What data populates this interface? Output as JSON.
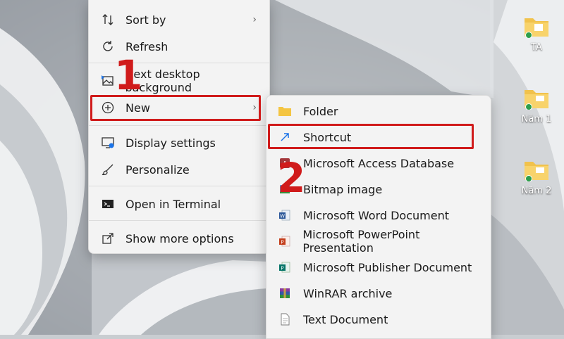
{
  "main_menu": {
    "items": [
      {
        "label": "Sort by",
        "icon": "sort-icon"
      },
      {
        "label": "Refresh",
        "icon": "refresh-icon"
      },
      {
        "label": "Next desktop background",
        "icon": "next-background-icon"
      },
      {
        "label": "New",
        "icon": "new-plus-icon"
      },
      {
        "label": "Display settings",
        "icon": "display-settings-icon"
      },
      {
        "label": "Personalize",
        "icon": "brush-icon"
      },
      {
        "label": "Open in Terminal",
        "icon": "terminal-icon"
      },
      {
        "label": "Show more options",
        "icon": "more-options-icon"
      }
    ]
  },
  "sub_menu": {
    "items": [
      {
        "label": "Folder",
        "icon": "folder-icon"
      },
      {
        "label": "Shortcut",
        "icon": "shortcut-arrow-icon"
      },
      {
        "label": "Microsoft Access Database",
        "icon": "access-icon"
      },
      {
        "label": "Bitmap image",
        "icon": "bitmap-icon"
      },
      {
        "label": "Microsoft Word Document",
        "icon": "word-icon"
      },
      {
        "label": "Microsoft PowerPoint Presentation",
        "icon": "powerpoint-icon"
      },
      {
        "label": "Microsoft Publisher Document",
        "icon": "publisher-icon"
      },
      {
        "label": "WinRAR archive",
        "icon": "winrar-icon"
      },
      {
        "label": "Text Document",
        "icon": "text-document-icon"
      }
    ]
  },
  "annotations": {
    "step1": "1",
    "step2": "2",
    "highlight_color": "#d01b1b"
  },
  "desktop_icons": [
    {
      "label": "TA"
    },
    {
      "label": "Năm 1"
    },
    {
      "label": "Năm 2"
    }
  ]
}
